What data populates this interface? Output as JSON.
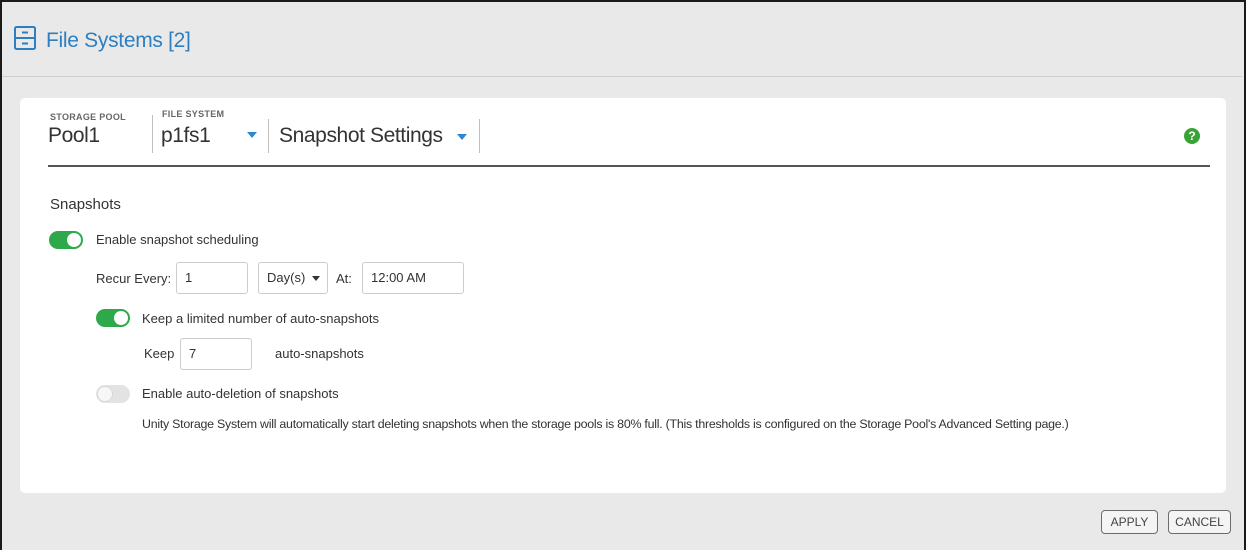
{
  "header": {
    "title": "File Systems [2]",
    "icon": "file-system-icon"
  },
  "breadcrumb": {
    "storage_pool_label": "STORAGE POOL",
    "storage_pool_value": "Pool1",
    "file_system_label": "FILE SYSTEM",
    "file_system_value": "p1fs1",
    "page_menu": "Snapshot Settings",
    "help": "?"
  },
  "snapshots": {
    "section_title": "Snapshots",
    "enable_scheduling": {
      "label": "Enable snapshot scheduling",
      "enabled": true
    },
    "recur_label": "Recur Every:",
    "recur_value": "1",
    "recur_unit": "Day(s)",
    "at_label": "At:",
    "at_value": "12:00 AM",
    "keep_limited": {
      "label": "Keep a limited number of auto-snapshots",
      "enabled": true
    },
    "keep_label": "Keep",
    "keep_value": "7",
    "keep_suffix": "auto-snapshots",
    "auto_delete": {
      "label": "Enable auto-deletion of snapshots",
      "enabled": false
    },
    "auto_delete_note": "Unity Storage System will automatically start deleting snapshots when the storage pools is 80% full. (This thresholds is configured on the Storage Pool's Advanced Setting page.)"
  },
  "actions": {
    "apply": "APPLY",
    "cancel": "CANCEL"
  },
  "colors": {
    "accent": "#2d7fc1",
    "toggle_on": "#2da84a",
    "help": "#3aa336"
  }
}
